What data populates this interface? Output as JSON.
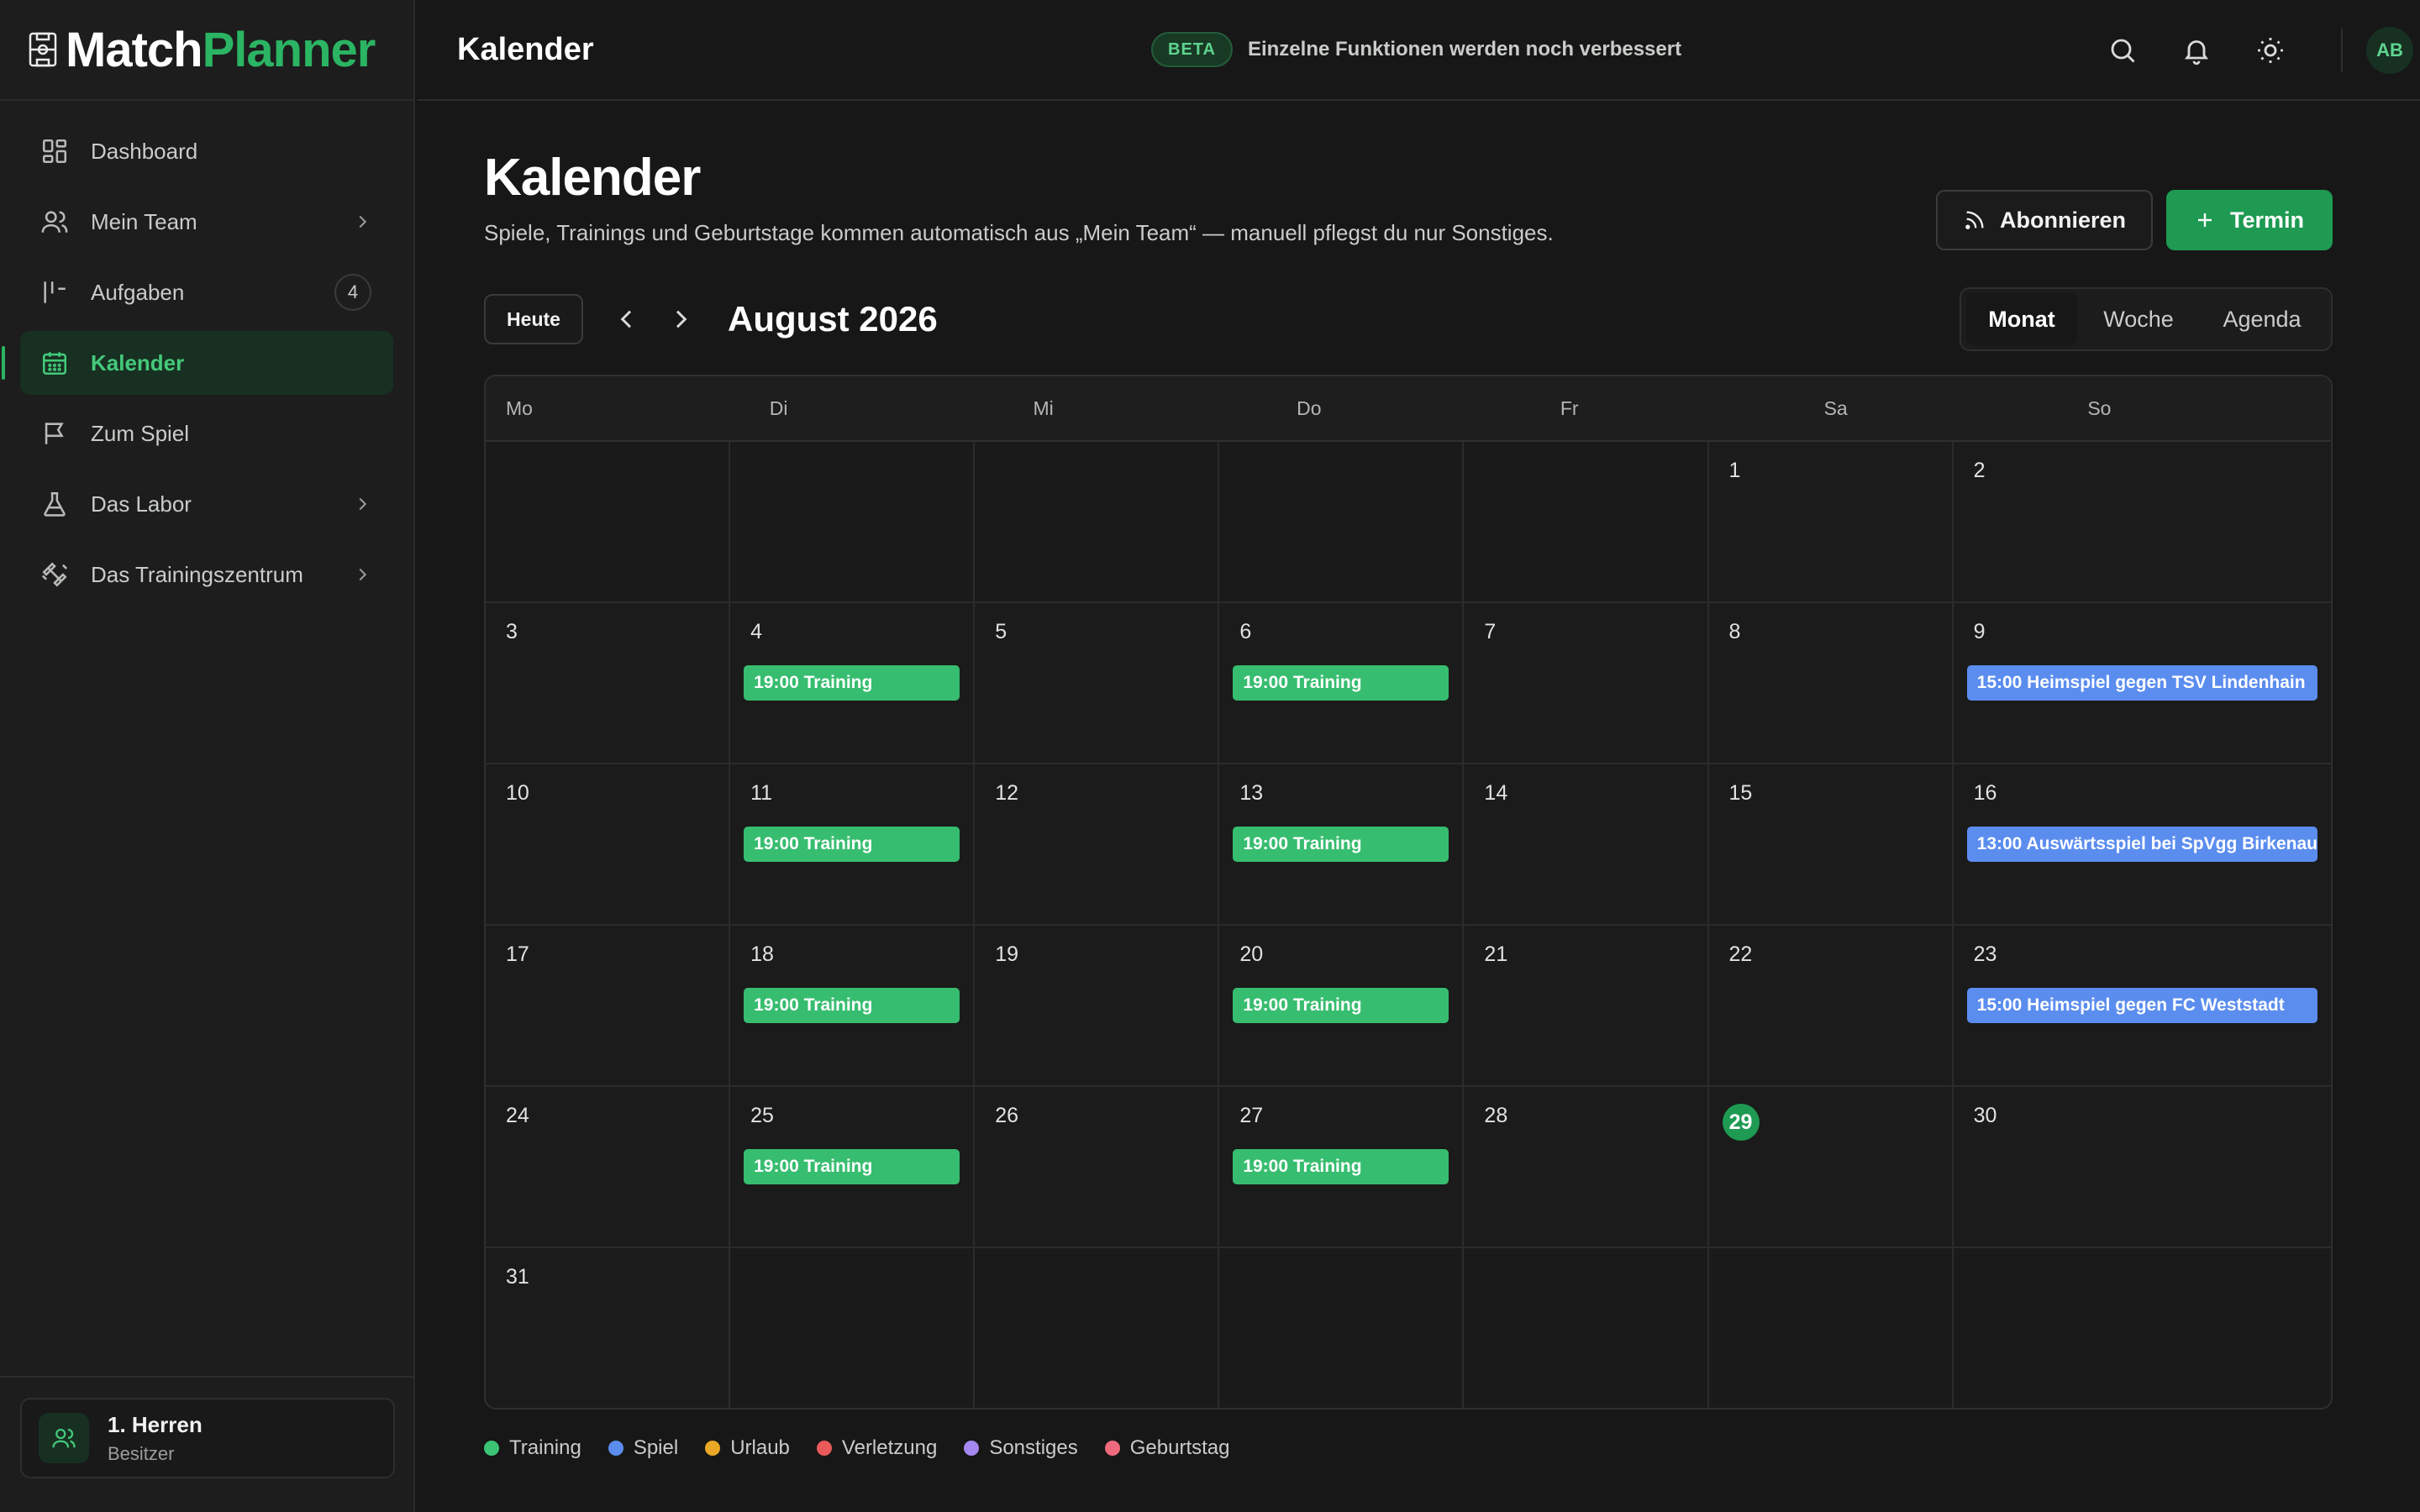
{
  "app": {
    "logo_part1": "Match",
    "logo_part2": "Planner"
  },
  "sidebar": {
    "items": [
      {
        "label": "Dashboard",
        "icon": "dashboard-icon"
      },
      {
        "label": "Mein Team",
        "icon": "users-icon",
        "expandable": true
      },
      {
        "label": "Aufgaben",
        "icon": "tasks-icon",
        "badge": "4"
      },
      {
        "label": "Kalender",
        "icon": "calendar-icon",
        "active": true
      },
      {
        "label": "Zum Spiel",
        "icon": "flag-icon"
      },
      {
        "label": "Das Labor",
        "icon": "flask-icon",
        "expandable": true
      },
      {
        "label": "Das Trainingszentrum",
        "icon": "dumbbell-icon",
        "expandable": true
      }
    ],
    "team": {
      "name": "1. Herren",
      "role": "Besitzer"
    }
  },
  "header": {
    "title": "Kalender",
    "beta_badge": "BETA",
    "beta_text": "Einzelne Funktionen werden noch verbessert",
    "avatar_initials": "AB"
  },
  "page": {
    "title": "Kalender",
    "subtitle": "Spiele, Trainings und Geburtstage kommen automatisch aus „Mein Team“ — manuell pflegst du nur Sonstiges.",
    "subscribe_label": "Abonnieren",
    "add_label": "Termin",
    "today_label": "Heute",
    "month_label": "August 2026",
    "views": [
      "Monat",
      "Woche",
      "Agenda"
    ],
    "active_view": "Monat"
  },
  "calendar": {
    "weekdays": [
      "Mo",
      "Di",
      "Mi",
      "Do",
      "Fr",
      "Sa",
      "So"
    ],
    "today": 29,
    "weeks": [
      [
        null,
        null,
        null,
        null,
        null,
        {
          "day": 1
        },
        {
          "day": 2
        }
      ],
      [
        {
          "day": 3
        },
        {
          "day": 4,
          "events": [
            {
              "text": "19:00 Training",
              "type": "training"
            }
          ]
        },
        {
          "day": 5
        },
        {
          "day": 6,
          "events": [
            {
              "text": "19:00 Training",
              "type": "training"
            }
          ]
        },
        {
          "day": 7
        },
        {
          "day": 8
        },
        {
          "day": 9,
          "events": [
            {
              "text": "15:00 Heimspiel gegen TSV Lindenhain",
              "type": "spiel"
            }
          ]
        }
      ],
      [
        {
          "day": 10
        },
        {
          "day": 11,
          "events": [
            {
              "text": "19:00 Training",
              "type": "training"
            }
          ]
        },
        {
          "day": 12
        },
        {
          "day": 13,
          "events": [
            {
              "text": "19:00 Training",
              "type": "training"
            }
          ]
        },
        {
          "day": 14
        },
        {
          "day": 15
        },
        {
          "day": 16,
          "events": [
            {
              "text": "13:00 Auswärtsspiel bei SpVgg Birkenau",
              "type": "spiel"
            }
          ]
        }
      ],
      [
        {
          "day": 17
        },
        {
          "day": 18,
          "events": [
            {
              "text": "19:00 Training",
              "type": "training"
            }
          ]
        },
        {
          "day": 19
        },
        {
          "day": 20,
          "events": [
            {
              "text": "19:00 Training",
              "type": "training"
            }
          ]
        },
        {
          "day": 21
        },
        {
          "day": 22
        },
        {
          "day": 23,
          "events": [
            {
              "text": "15:00 Heimspiel gegen FC Weststadt",
              "type": "spiel"
            }
          ]
        }
      ],
      [
        {
          "day": 24
        },
        {
          "day": 25,
          "events": [
            {
              "text": "19:00 Training",
              "type": "training"
            }
          ]
        },
        {
          "day": 26
        },
        {
          "day": 27,
          "events": [
            {
              "text": "19:00 Training",
              "type": "training"
            }
          ]
        },
        {
          "day": 28
        },
        {
          "day": 29
        },
        {
          "day": 30
        }
      ],
      [
        {
          "day": 31
        },
        null,
        null,
        null,
        null,
        null,
        null
      ]
    ]
  },
  "legend": [
    {
      "label": "Training",
      "color": "#3cc374"
    },
    {
      "label": "Spiel",
      "color": "#5b8def"
    },
    {
      "label": "Urlaub",
      "color": "#e9a825"
    },
    {
      "label": "Verletzung",
      "color": "#ea5a5a"
    },
    {
      "label": "Sonstiges",
      "color": "#a487f0"
    },
    {
      "label": "Geburtstag",
      "color": "#f06a7d"
    }
  ],
  "colors": {
    "training": "#37bd6f",
    "spiel": "#5b8def",
    "accent": "#2bb463"
  }
}
